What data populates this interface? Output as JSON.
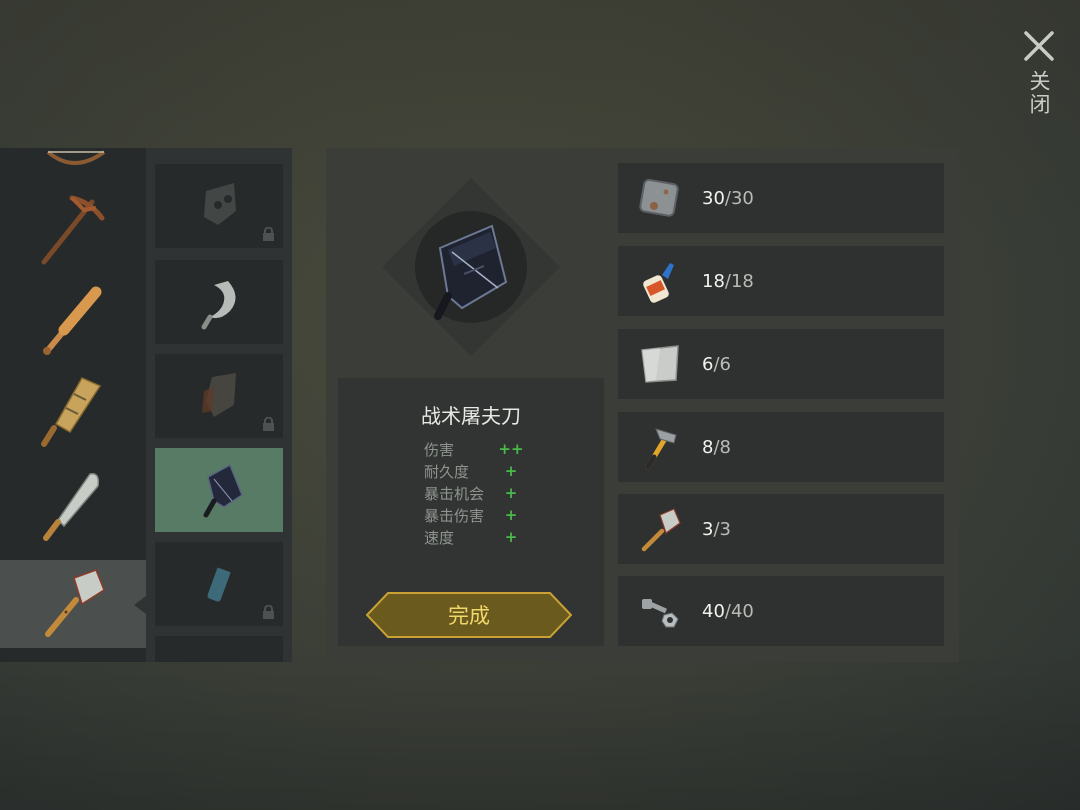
{
  "close": {
    "label": "关闭",
    "icon": "close-icon"
  },
  "tools": [
    {
      "name": "bow",
      "icon": "bow-icon"
    },
    {
      "name": "pickaxe",
      "icon": "pickaxe-icon"
    },
    {
      "name": "baseball-bat",
      "icon": "baseball-bat-icon"
    },
    {
      "name": "plank-club",
      "icon": "plank-club-icon"
    },
    {
      "name": "machete",
      "icon": "machete-icon"
    },
    {
      "name": "cleaver",
      "icon": "cleaver-icon",
      "selected": true
    }
  ],
  "recipes": [
    {
      "icon": "cleaver-blade-icon",
      "locked": true
    },
    {
      "icon": "sickle-icon",
      "locked": false
    },
    {
      "icon": "spiked-cleaver-icon",
      "locked": true
    },
    {
      "icon": "tactical-cleaver-icon",
      "locked": false,
      "active": true
    },
    {
      "icon": "taped-handle-icon",
      "locked": true
    },
    {
      "icon": "partial-item-icon",
      "locked": false
    }
  ],
  "detail": {
    "item_name": "战术屠夫刀",
    "stats": [
      {
        "name": "伤害",
        "value": "++"
      },
      {
        "name": "耐久度",
        "value": "+"
      },
      {
        "name": "暴击机会",
        "value": "+"
      },
      {
        "name": "暴击伤害",
        "value": "+"
      },
      {
        "name": "速度",
        "value": "+"
      }
    ],
    "done_label": "完成"
  },
  "materials": [
    {
      "icon": "metal-plate-icon",
      "have": "30",
      "sep": "/",
      "need": "30"
    },
    {
      "icon": "glue-icon",
      "have": "18",
      "sep": "/",
      "need": "18"
    },
    {
      "icon": "steel-sheet-icon",
      "have": "6",
      "sep": "/",
      "need": "6"
    },
    {
      "icon": "hammer-icon",
      "have": "8",
      "sep": "/",
      "need": "8"
    },
    {
      "icon": "cleaver-icon",
      "have": "3",
      "sep": "/",
      "need": "3"
    },
    {
      "icon": "bolts-icon",
      "have": "40",
      "sep": "/",
      "need": "40"
    }
  ],
  "colors": {
    "accent_gold": "#c9a233",
    "done_text": "#f0d86a",
    "stat_plus": "#49b94a",
    "active_slot": "#587b65"
  }
}
